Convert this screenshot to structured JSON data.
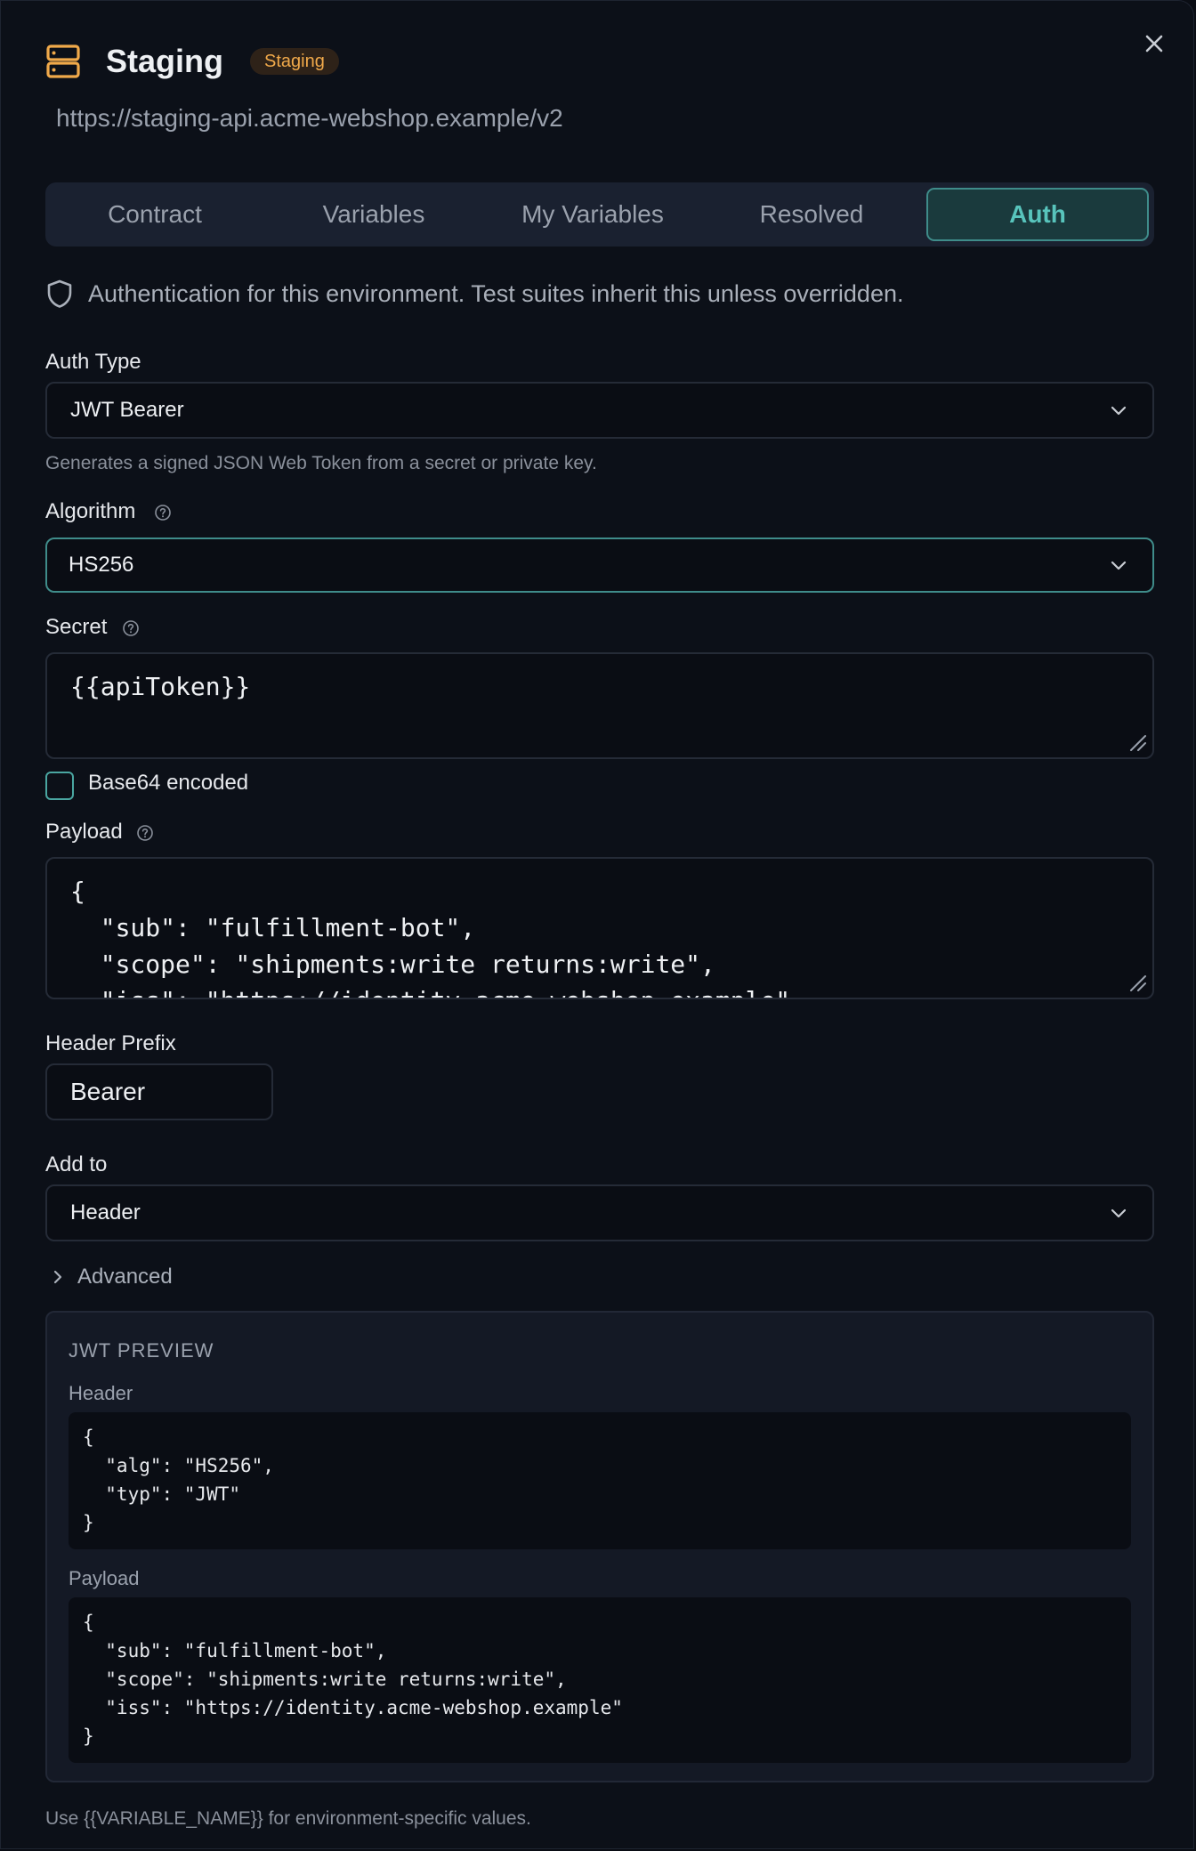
{
  "header": {
    "title": "Staging",
    "badge": "Staging",
    "url": "https://staging-api.acme-webshop.example/v2"
  },
  "tabs": [
    {
      "label": "Contract"
    },
    {
      "label": "Variables"
    },
    {
      "label": "My Variables"
    },
    {
      "label": "Resolved"
    },
    {
      "label": "Auth",
      "active": true
    }
  ],
  "auth": {
    "note": "Authentication for this environment. Test suites inherit this unless overridden.",
    "auth_type": {
      "label": "Auth Type",
      "value": "JWT Bearer",
      "hint": "Generates a signed JSON Web Token from a secret or private key."
    },
    "algorithm": {
      "label": "Algorithm",
      "value": "HS256"
    },
    "secret": {
      "label": "Secret",
      "value": "{{apiToken}}"
    },
    "base64": {
      "label": "Base64 encoded",
      "checked": false
    },
    "payload": {
      "label": "Payload",
      "lines": [
        "{",
        "  \"sub\": \"fulfillment-bot\",",
        "  \"scope\": \"shipments:write returns:write\",",
        "  \"iss\": \"https://identity.acme-webshop.example\""
      ]
    },
    "header_prefix": {
      "label": "Header Prefix",
      "value": "Bearer"
    },
    "add_to": {
      "label": "Add to",
      "value": "Header"
    },
    "advanced": {
      "label": "Advanced"
    }
  },
  "preview": {
    "title": "JWT PREVIEW",
    "header_label": "Header",
    "header_lines": [
      "{",
      "  \"alg\": \"HS256\",",
      "  \"typ\": \"JWT\"",
      "}"
    ],
    "payload_label": "Payload",
    "payload_lines": [
      "{",
      "  \"sub\": \"fulfillment-bot\",",
      "  \"scope\": \"shipments:write returns:write\",",
      "  \"iss\": \"https://identity.acme-webshop.example\"",
      "}"
    ]
  },
  "footer": {
    "hint": "Use {{VARIABLE_NAME}} for environment-specific values."
  },
  "colors": {
    "accent": "#3f8c8a",
    "badge": "#f0a94a",
    "background": "#0c1018"
  }
}
